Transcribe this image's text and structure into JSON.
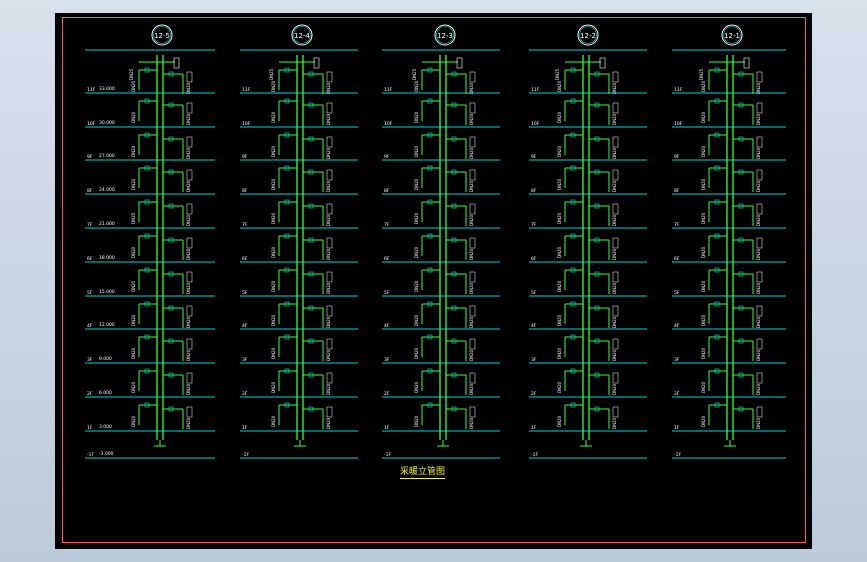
{
  "drawing": {
    "title": "采暖立管图",
    "colors": {
      "background": "#000000",
      "frame": "#ff5a5a",
      "floor_line": "#00d2d2",
      "pipe": "#38ff38",
      "label": "#ffffff",
      "title": "#f1f14a"
    },
    "columns": [
      {
        "riser_id": "12-5",
        "floor_labels": [
          "11F",
          "10F",
          "9F",
          "8F",
          "7F",
          "6F",
          "5F",
          "4F",
          "3F",
          "2F",
          "1F",
          "-1F"
        ],
        "elevations": [
          "33.000",
          "30.000",
          "27.000",
          "24.000",
          "21.000",
          "18.000",
          "15.000",
          "12.000",
          "9.000",
          "6.000",
          "3.000",
          "-3.000"
        ]
      },
      {
        "riser_id": "12-4",
        "floor_labels": [
          "11F",
          "10F",
          "9F",
          "8F",
          "7F",
          "6F",
          "5F",
          "4F",
          "3F",
          "2F",
          "1F",
          "-1F"
        ],
        "elevations": []
      },
      {
        "riser_id": "12-3",
        "floor_labels": [
          "11F",
          "10F",
          "9F",
          "8F",
          "7F",
          "6F",
          "5F",
          "4F",
          "3F",
          "2F",
          "1F",
          "-1F"
        ],
        "elevations": []
      },
      {
        "riser_id": "12-2",
        "floor_labels": [
          "11F",
          "10F",
          "9F",
          "8F",
          "7F",
          "6F",
          "5F",
          "4F",
          "3F",
          "2F",
          "1F",
          "-1F"
        ],
        "elevations": []
      },
      {
        "riser_id": "12-1",
        "floor_labels": [
          "11F",
          "10F",
          "9F",
          "8F",
          "7F",
          "6F",
          "5F",
          "4F",
          "3F",
          "2F",
          "1F",
          "-1F"
        ],
        "elevations": []
      }
    ],
    "radiator_tag": "DN20",
    "pipe_tag": "DN25"
  }
}
